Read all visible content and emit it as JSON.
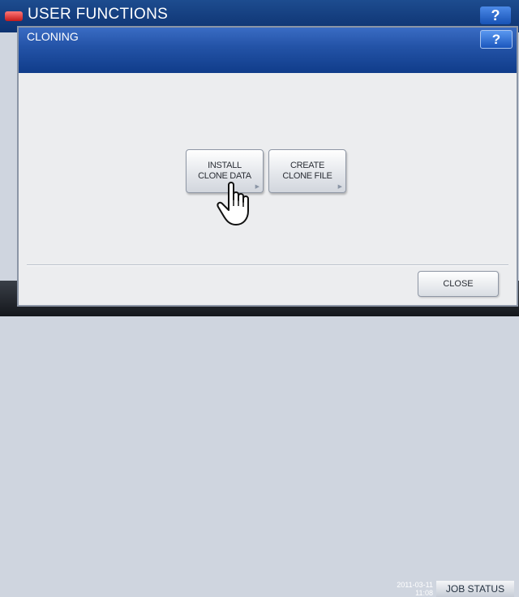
{
  "background": {
    "header_title": "USER FUNCTIONS",
    "help_label": "?",
    "datetime": "2011-03-11\n11:08",
    "job_status_label": "JOB STATUS"
  },
  "dialog": {
    "title": "CLONING",
    "help_label": "?",
    "options": [
      {
        "label": "INSTALL\nCLONE DATA"
      },
      {
        "label": "CREATE\nCLONE FILE"
      }
    ],
    "close_label": "CLOSE"
  },
  "icons": {
    "pointer": "hand-pointer-icon",
    "arrow": "triangle-right-icon"
  }
}
